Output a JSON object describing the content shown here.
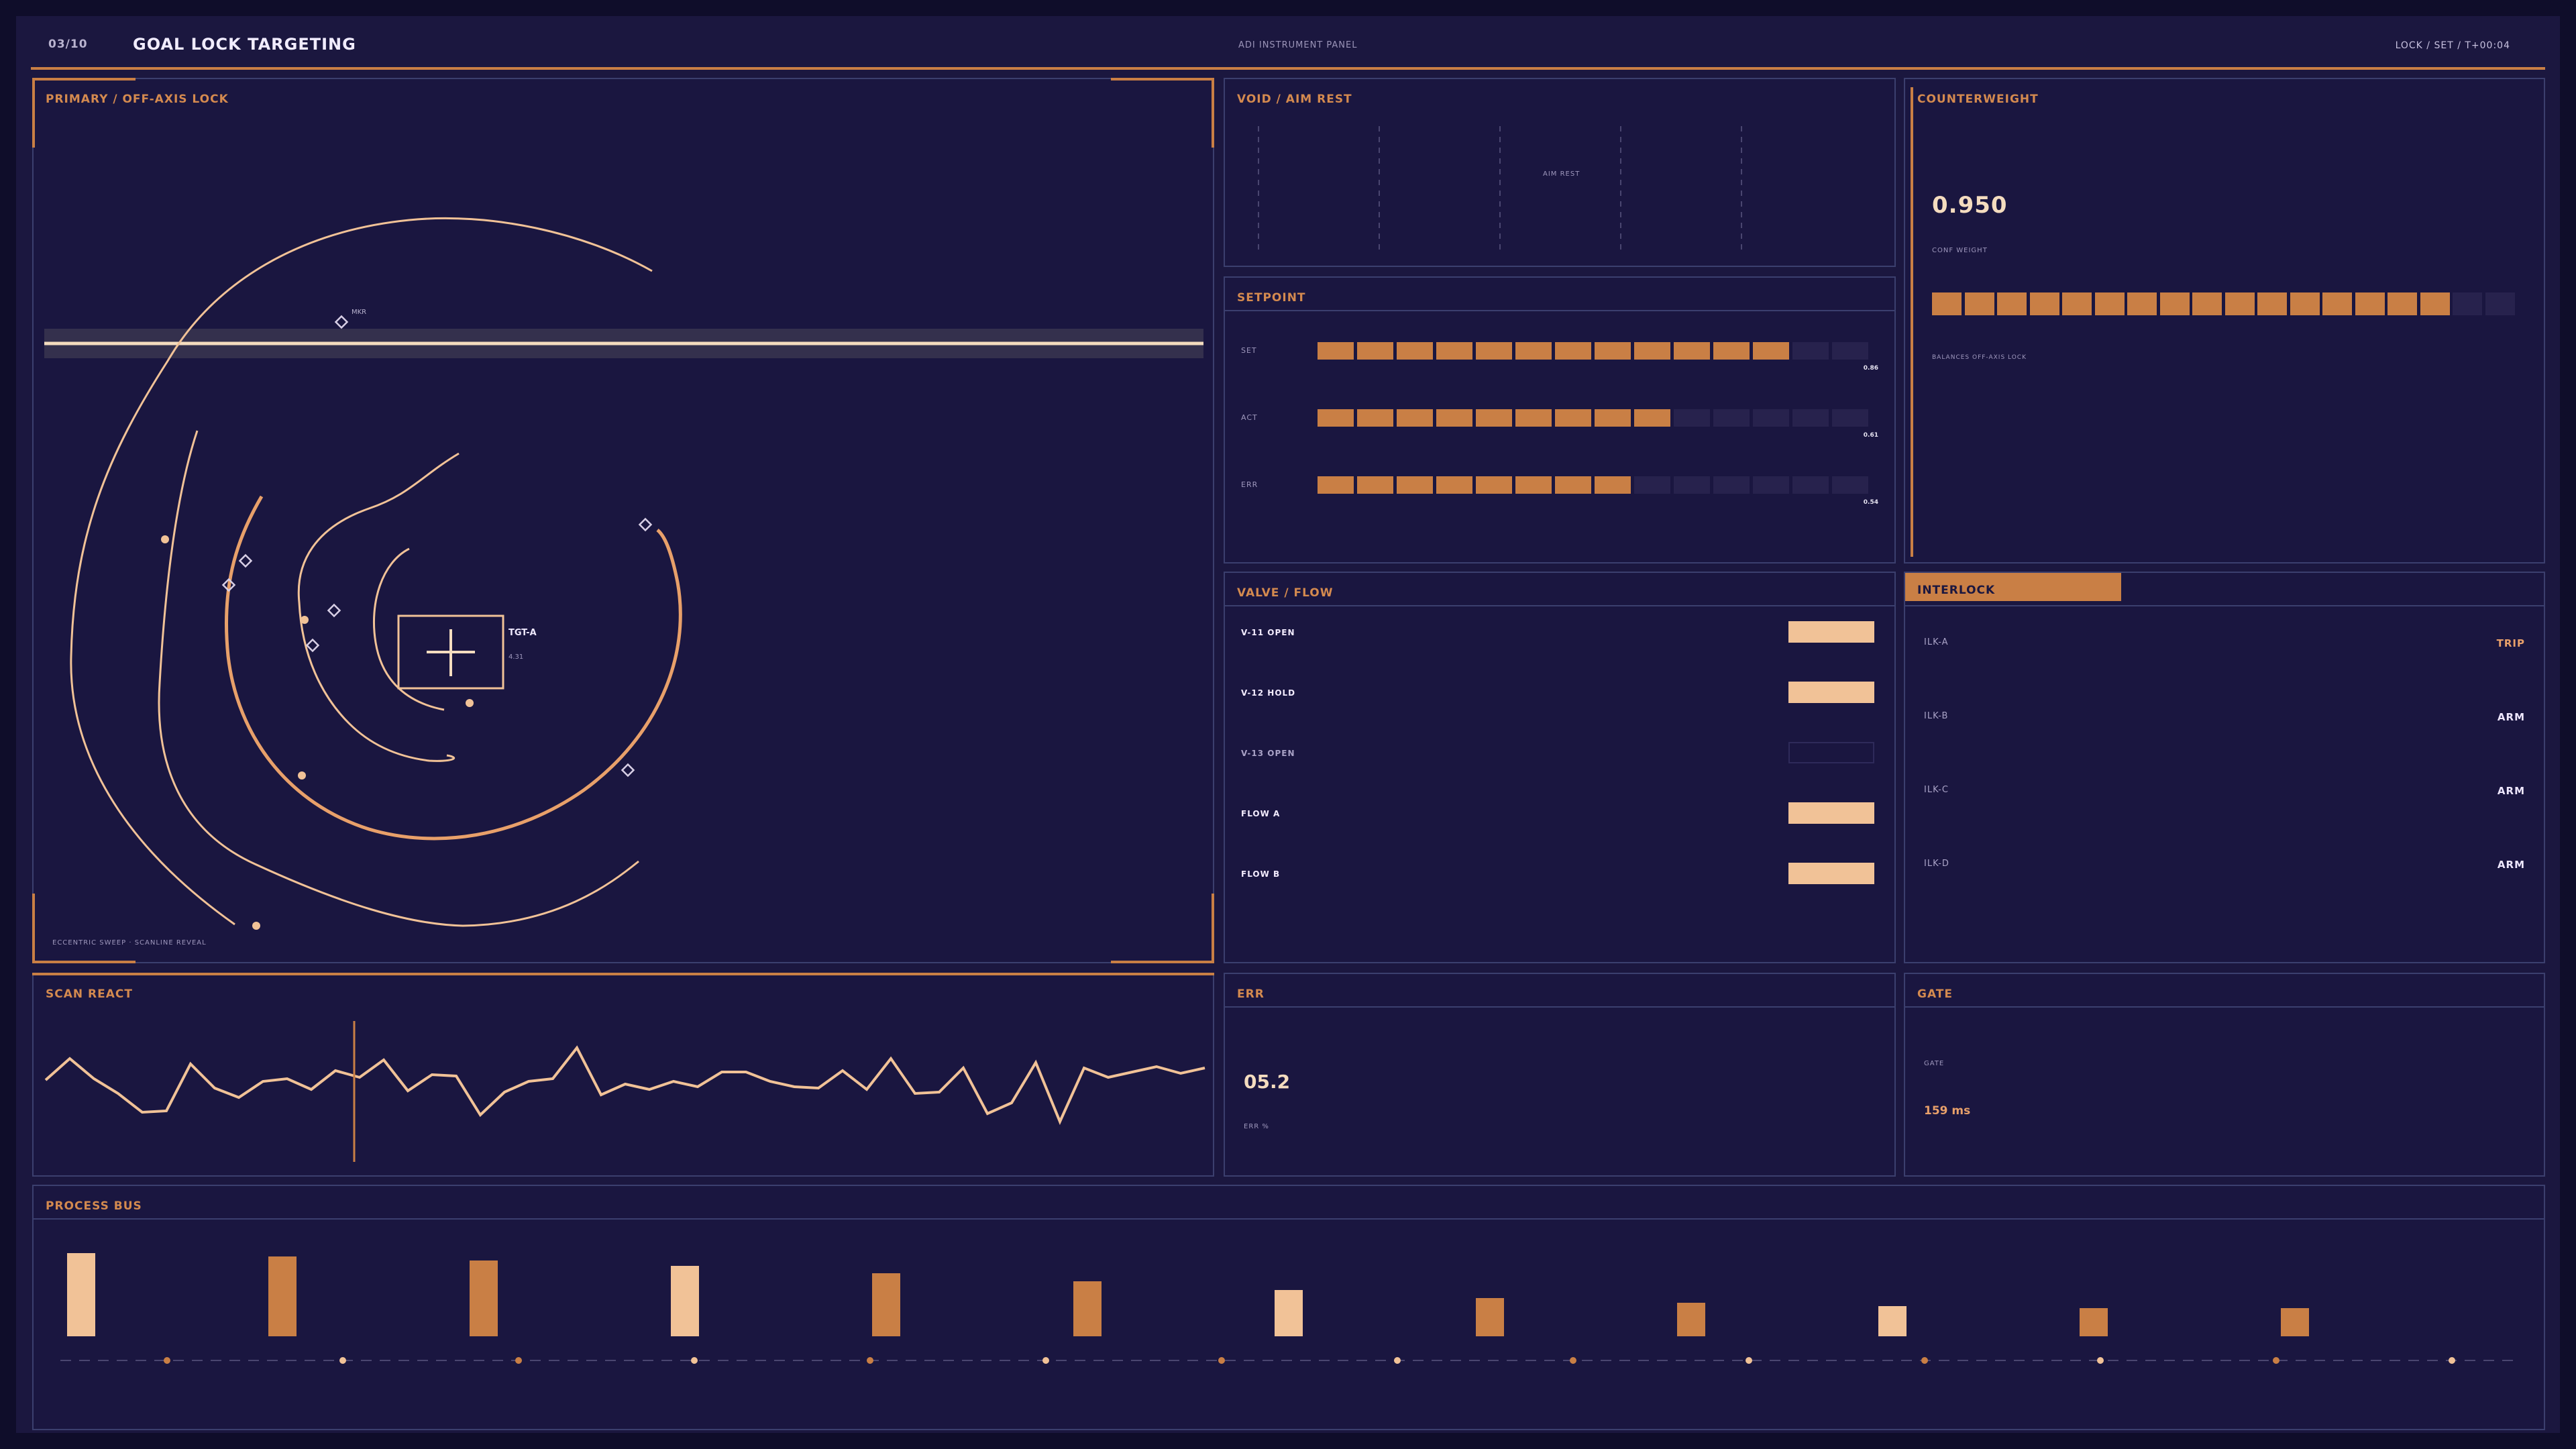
{
  "header": {
    "page_counter": "03/10",
    "title": "GOAL LOCK TARGETING",
    "center_label": "ADI INSTRUMENT PANEL",
    "right_label": "LOCK / SET / T+00:04"
  },
  "primary": {
    "title": "PRIMARY / OFF-AXIS LOCK",
    "target_label": "TGT-A",
    "target_sub": "4.31",
    "marker_label": "MKR",
    "footer": "ECCENTRIC SWEEP · SCANLINE REVEAL"
  },
  "void": {
    "title": "VOID / AIM REST",
    "center_label": "AIM REST"
  },
  "setpoint": {
    "title": "SETPOINT",
    "rows": [
      {
        "label": "SET",
        "value": "0.86",
        "fill": 0.86
      },
      {
        "label": "ACT",
        "value": "0.61",
        "fill": 0.61
      },
      {
        "label": "ERR",
        "value": "0.54",
        "fill": 0.54
      }
    ]
  },
  "counterweight": {
    "title": "COUNTERWEIGHT",
    "value": "0.950",
    "value_label": "CONF WEIGHT",
    "fill": 0.9,
    "footer": "BALANCES OFF-AXIS LOCK"
  },
  "valve": {
    "title": "VALVE / FLOW",
    "rows": [
      {
        "label": "V-11 OPEN",
        "on": true
      },
      {
        "label": "V-12 HOLD",
        "on": true
      },
      {
        "label": "V-13 OPEN",
        "on": false
      },
      {
        "label": "FLOW A",
        "on": true
      },
      {
        "label": "FLOW B",
        "on": true
      }
    ]
  },
  "interlock": {
    "title": "INTERLOCK",
    "rows": [
      {
        "label": "ILK-A",
        "value": "TRIP"
      },
      {
        "label": "ILK-B",
        "value": "ARM"
      },
      {
        "label": "ILK-C",
        "value": "ARM"
      },
      {
        "label": "ILK-D",
        "value": "ARM"
      }
    ]
  },
  "scan": {
    "title": "SCAN REACT"
  },
  "err": {
    "title": "ERR",
    "value": "05.2",
    "value_label": "ERR %"
  },
  "gate": {
    "title": "GATE",
    "label": "GATE",
    "value": "159 ms"
  },
  "bus": {
    "title": "PROCESS BUS",
    "levels": [
      1.0,
      0.96,
      0.91,
      0.85,
      0.76,
      0.66,
      0.56,
      0.46,
      0.4,
      0.36,
      0.34,
      0.34
    ],
    "light": [
      true,
      false,
      false,
      true,
      false,
      false,
      true,
      false,
      false,
      true,
      false,
      false
    ]
  },
  "colors": {
    "accent": "#c97f45",
    "light": "#f1c297",
    "panel": "#1a1640",
    "border": "#3b3f6e"
  }
}
